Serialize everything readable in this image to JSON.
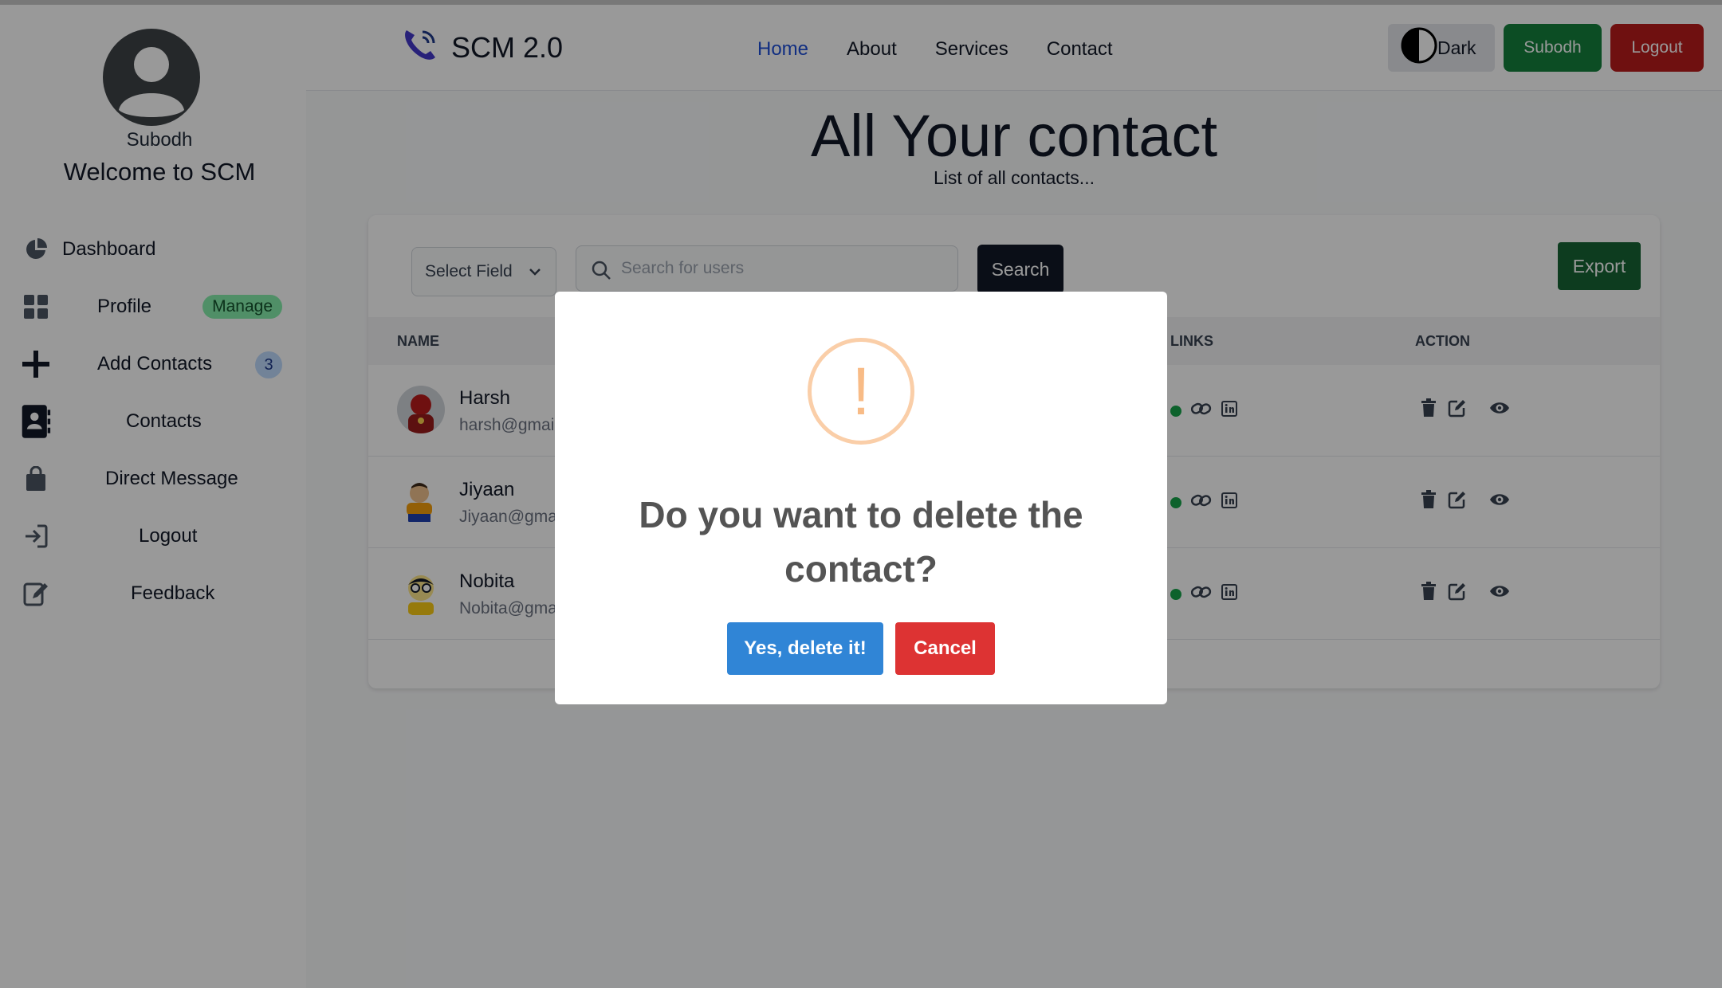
{
  "sidebar": {
    "user_name": "Subodh",
    "welcome": "Welcome to SCM",
    "items": [
      {
        "label": "Dashboard",
        "icon": "pie-chart-icon"
      },
      {
        "label": "Profile",
        "icon": "grid-icon",
        "badge": "Manage"
      },
      {
        "label": "Add Contacts",
        "icon": "plus-icon",
        "badge": "3"
      },
      {
        "label": "Contacts",
        "icon": "contact-book-icon"
      },
      {
        "label": "Direct Message",
        "icon": "bag-icon"
      },
      {
        "label": "Logout",
        "icon": "sign-out-icon"
      },
      {
        "label": "Feedback",
        "icon": "edit-note-icon"
      }
    ]
  },
  "navbar": {
    "brand": "SCM 2.0",
    "links": [
      "Home",
      "About",
      "Services",
      "Contact"
    ],
    "active_link": "Home",
    "dark_label": "Dark",
    "user_button": "Subodh",
    "logout_button": "Logout"
  },
  "main": {
    "title": "All Your contact",
    "subtitle": "List of all contacts..."
  },
  "toolbar": {
    "select_label": "Select Field",
    "search_placeholder": "Search for users",
    "search_button": "Search",
    "export_button": "Export"
  },
  "table": {
    "headers": {
      "name": "NAME",
      "links": "LINKS",
      "action": "ACTION"
    },
    "rows": [
      {
        "name": "Harsh",
        "email": "harsh@gmail"
      },
      {
        "name": "Jiyaan",
        "email": "Jiyaan@gmai"
      },
      {
        "name": "Nobita",
        "email": "Nobita@gma"
      }
    ]
  },
  "modal": {
    "icon_text": "!",
    "question": "Do you want to delete the contact?",
    "confirm": "Yes, delete it!",
    "cancel": "Cancel"
  },
  "colors": {
    "confirm": "#3085d6",
    "cancel": "#dd3333",
    "active_nav": "#1d4ed8",
    "green": "#15803d",
    "red": "#b91c1c"
  }
}
